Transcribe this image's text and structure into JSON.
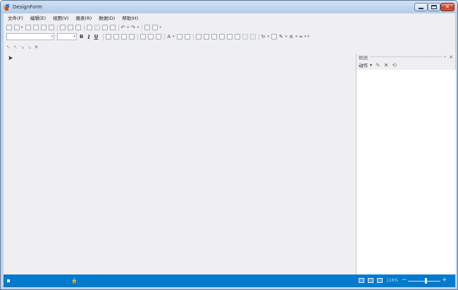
{
  "window": {
    "title": "DesignForm",
    "min_icon": "minimize-icon",
    "max_icon": "maximize-icon",
    "close_glyph": "✕"
  },
  "menu": {
    "items": [
      {
        "label": "文件(F)"
      },
      {
        "label": "编辑(E)"
      },
      {
        "label": "视图(V)"
      },
      {
        "label": "报表(R)"
      },
      {
        "label": "数据(D)"
      },
      {
        "label": "帮助(H)"
      }
    ]
  },
  "format_toolbar": {
    "bold": "B",
    "italic": "I",
    "underline": "U"
  },
  "data_panel": {
    "title": "数据",
    "pin_glyph": "ᵖ",
    "close_glyph": "×",
    "action_label": "动作",
    "action_dropdown": "▾"
  },
  "status": {
    "zoom": "116%",
    "zoom_level": 0.55
  },
  "colors": {
    "accent": "#007acc",
    "workspace": "#efeff2",
    "title_bar": "#bfd3ea",
    "close_button": "#c5452a"
  }
}
